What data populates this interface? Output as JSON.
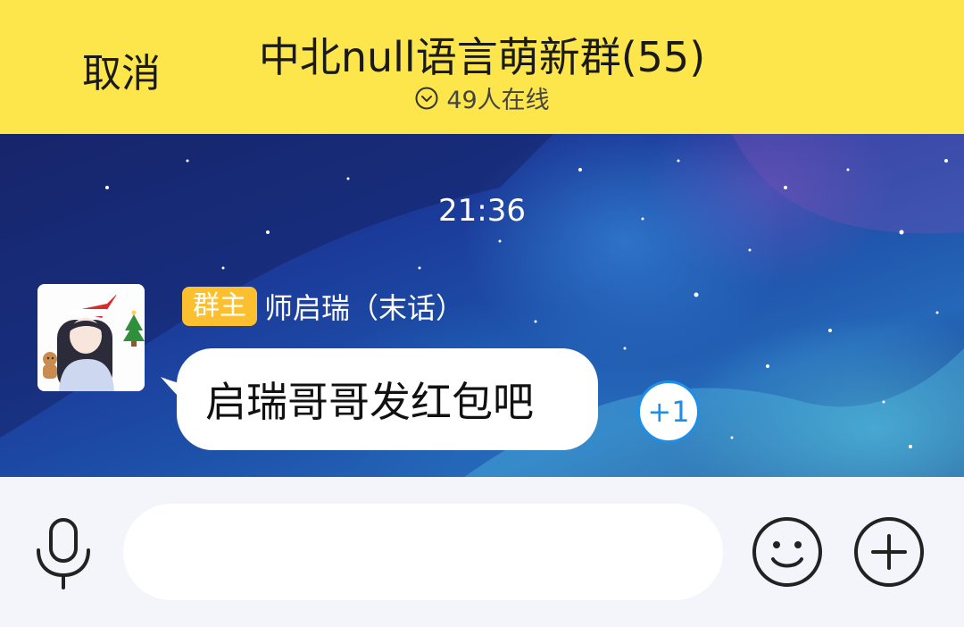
{
  "header": {
    "cancel_label": "取消",
    "title": "中北null语言萌新群(55)",
    "online_text": "49人在线",
    "online_icon": "chevron-down-circle-icon",
    "background": "#fde64b"
  },
  "chat": {
    "timestamp": "21:36",
    "messages": [
      {
        "role_badge": "群主",
        "sender": "师启瑞（末话）",
        "text": "启瑞哥哥发红包吧",
        "reaction": "+1"
      }
    ]
  },
  "input_bar": {
    "voice_icon": "microphone-icon",
    "message_value": "",
    "emoji_icon": "smiley-icon",
    "more_icon": "plus-circle-icon"
  },
  "colors": {
    "accent_yellow": "#fde64b",
    "badge": "#fcbf2f",
    "reaction_blue": "#1e8fe8"
  }
}
